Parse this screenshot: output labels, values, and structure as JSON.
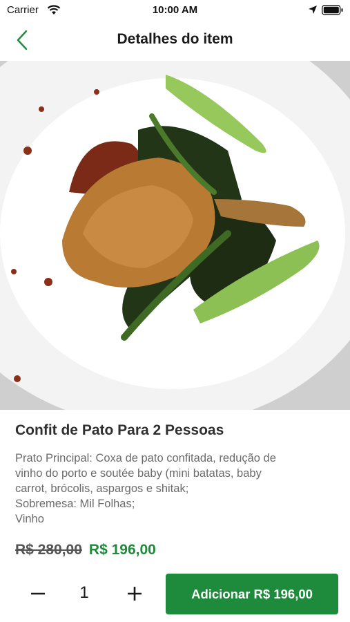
{
  "status_bar": {
    "carrier": "Carrier",
    "time": "10:00 AM",
    "icons": [
      "wifi-icon",
      "location-arrow-icon",
      "battery-icon"
    ]
  },
  "nav": {
    "title": "Detalhes do item",
    "back_icon": "chevron-left-icon",
    "accent_color": "#1e8b3c"
  },
  "item": {
    "image": "photo of confit duck leg with greens on a white plate",
    "name": "Confit de Pato Para 2 Pessoas",
    "description_lines": [
      "Prato Principal: Coxa de pato confitada, redução de",
      "vinho do porto e soutée baby (mini batatas, baby",
      "carrot, brócolis, aspargos e shitak;",
      "Sobremesa: Mil Folhas;",
      "Vinho"
    ],
    "old_price": "R$ 280,00",
    "new_price": "R$ 196,00",
    "price_color": "#1f8a3a"
  },
  "quantity": {
    "minus_icon": "minus-icon",
    "value": "1",
    "plus_icon": "plus-icon"
  },
  "add_button": {
    "label": "Adicionar R$ 196,00",
    "color": "#1e8b3c"
  }
}
